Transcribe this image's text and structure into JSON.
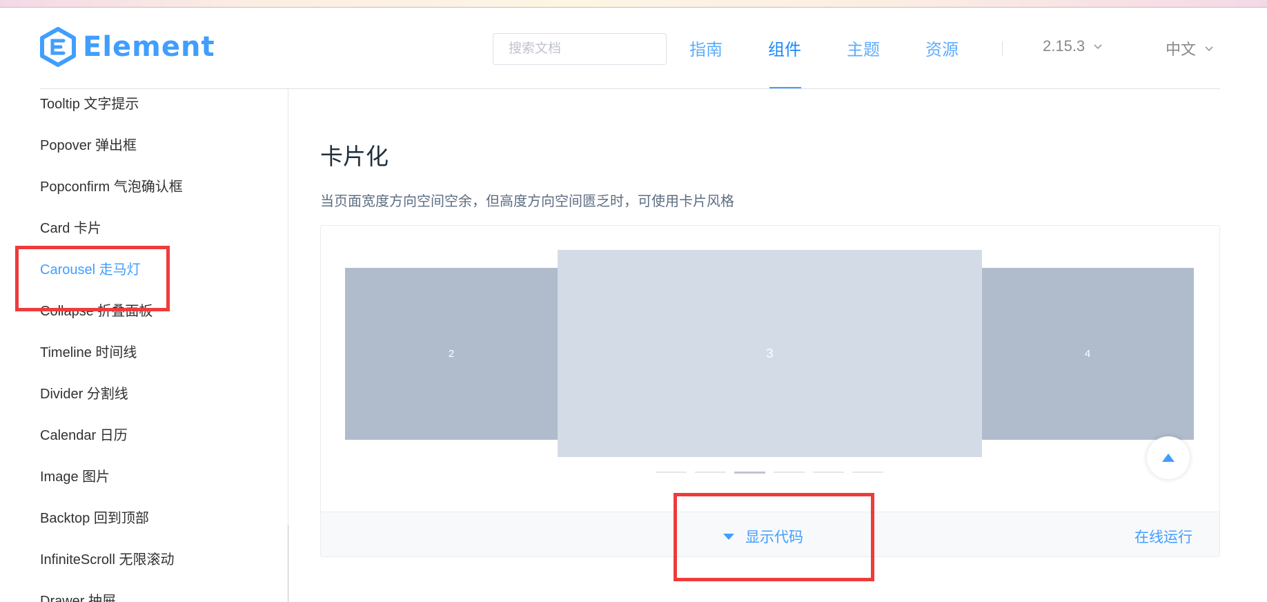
{
  "header": {
    "logo_text": "Element",
    "search_placeholder": "搜索文档",
    "nav": [
      {
        "label": "指南"
      },
      {
        "label": "组件",
        "active": true
      },
      {
        "label": "主题"
      },
      {
        "label": "资源"
      }
    ],
    "version": "2.15.3",
    "language": "中文"
  },
  "sidebar": {
    "items": [
      {
        "label": "Tooltip 文字提示"
      },
      {
        "label": "Popover 弹出框"
      },
      {
        "label": "Popconfirm 气泡确认框"
      },
      {
        "label": "Card 卡片"
      },
      {
        "label": "Carousel 走马灯",
        "active": true
      },
      {
        "label": "Collapse 折叠面板"
      },
      {
        "label": "Timeline 时间线"
      },
      {
        "label": "Divider 分割线"
      },
      {
        "label": "Calendar 日历"
      },
      {
        "label": "Image 图片"
      },
      {
        "label": "Backtop 回到顶部"
      },
      {
        "label": "InfiniteScroll 无限滚动"
      },
      {
        "label": "Drawer 抽屉"
      }
    ]
  },
  "main": {
    "title": "卡片化",
    "description": "当页面宽度方向空间空余，但高度方向空间匮乏时，可使用卡片风格",
    "carousel": {
      "left_card": "2",
      "center_card": "3",
      "right_card": "4",
      "indicator_count": 6,
      "active_indicator": 3
    },
    "show_code_label": "显示代码",
    "run_online_label": "在线运行"
  },
  "colors": {
    "accent": "#409eff",
    "highlight_box": "#ee3b3b",
    "card_side": "#b0bccc",
    "card_center": "#d3dce6"
  }
}
